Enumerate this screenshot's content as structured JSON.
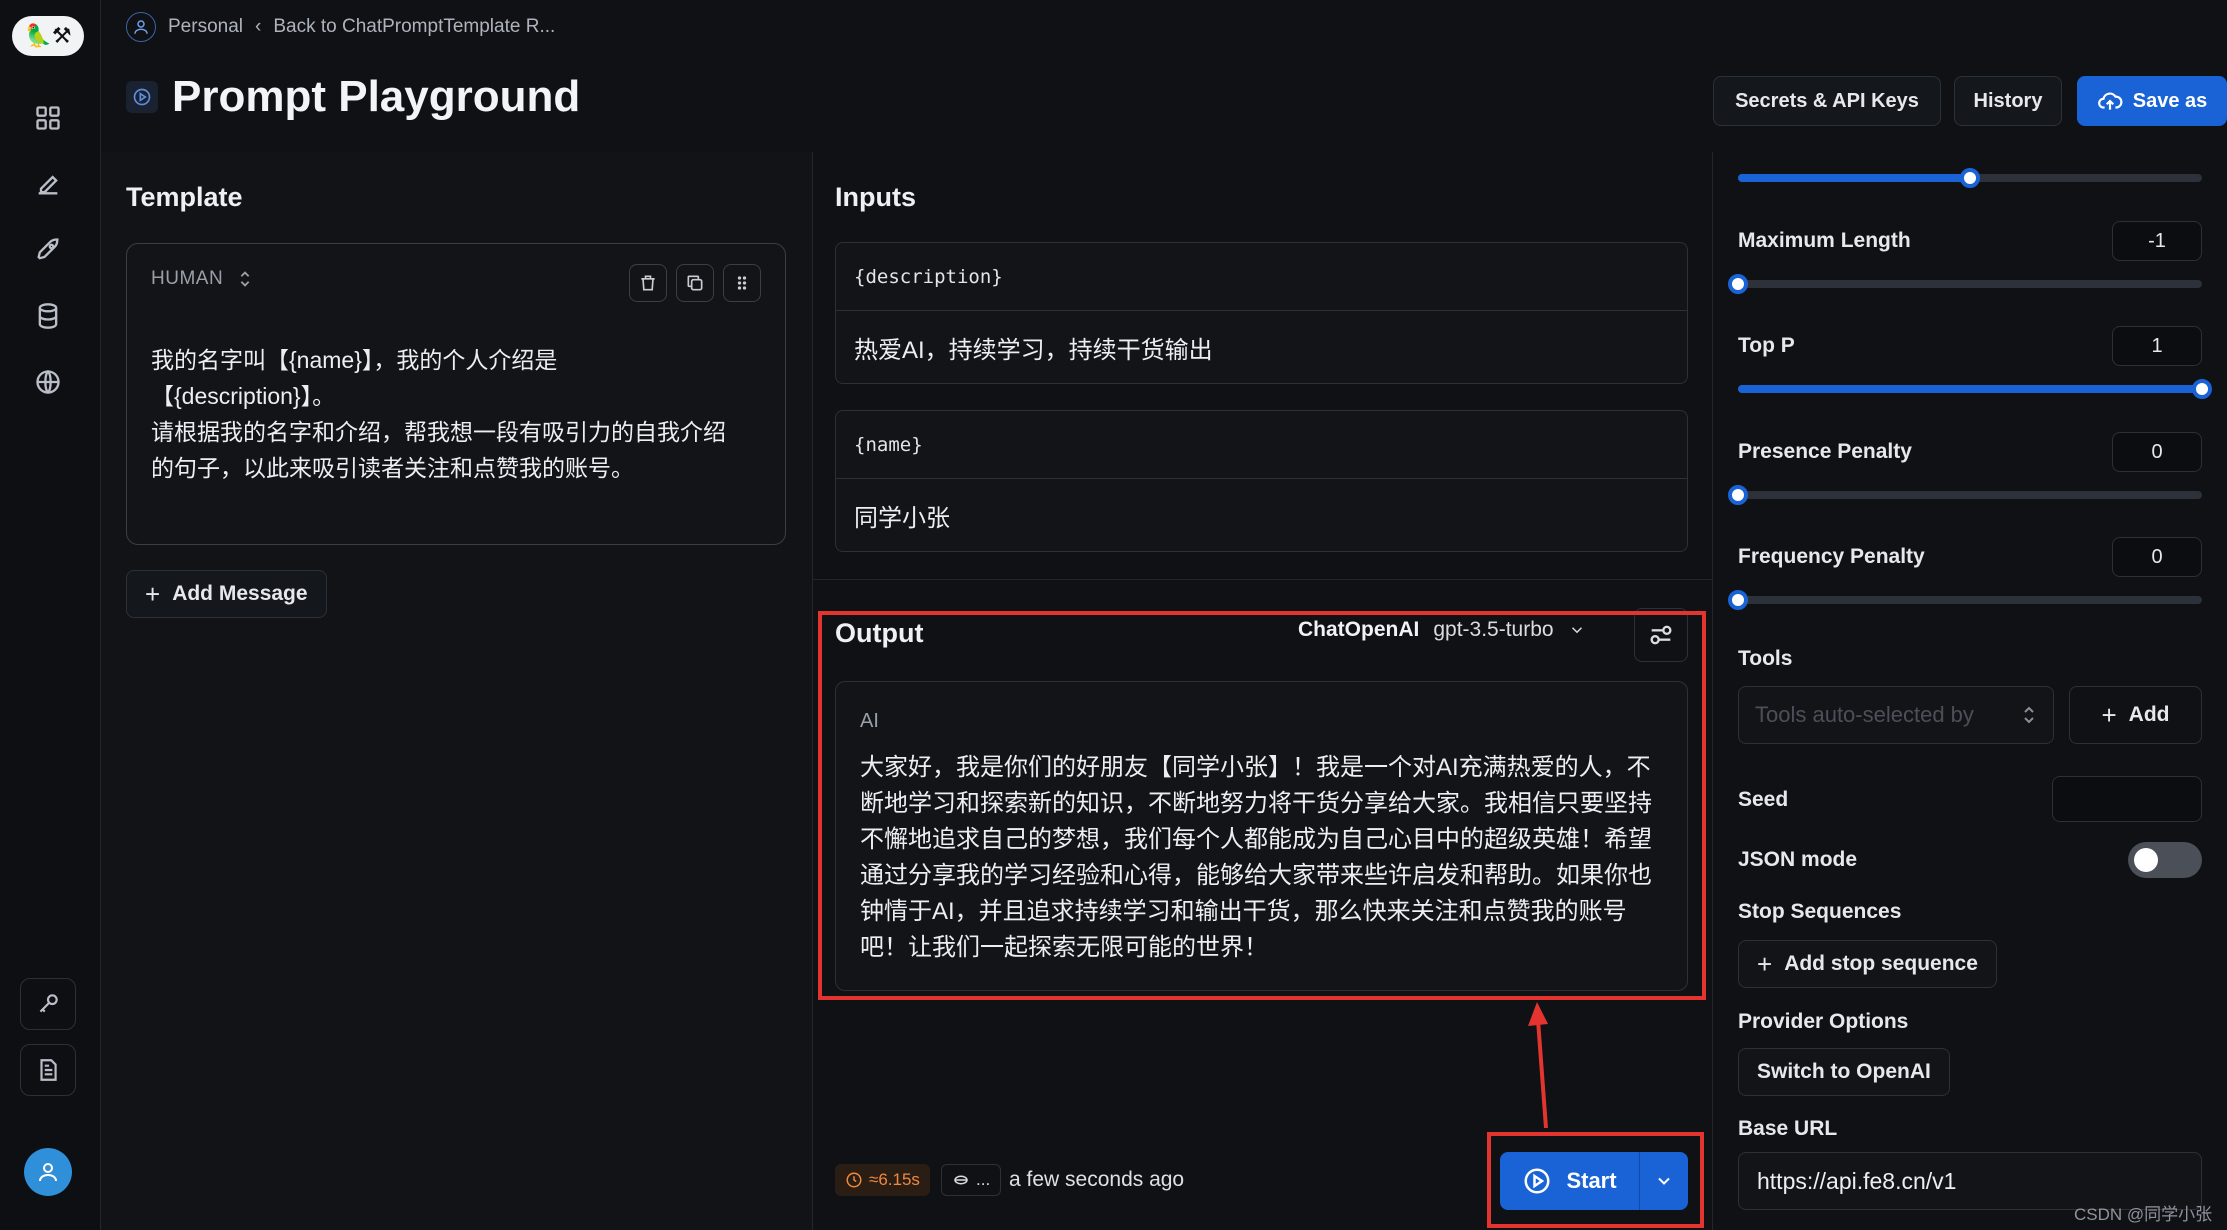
{
  "breadcrumb": {
    "workspace": "Personal",
    "back": "Back to ChatPromptTemplate R..."
  },
  "header": {
    "title": "Prompt Playground",
    "secrets_label": "Secrets & API Keys",
    "history_label": "History",
    "save_label": "Save as"
  },
  "template": {
    "title": "Template",
    "role": "HUMAN",
    "message": "我的名字叫【{name}】，我的个人介绍是\n【{description}】。\n请根据我的名字和介绍，帮我想一段有吸引力的自我介绍\n的句子，以此来吸引读者关注和点赞我的账号。",
    "add_message": "Add Message"
  },
  "inputs": {
    "title": "Inputs",
    "items": [
      {
        "key": "{description}",
        "value": "热爱AI，持续学习，持续干货输出"
      },
      {
        "key": "{name}",
        "value": "同学小张"
      }
    ]
  },
  "output": {
    "title": "Output",
    "provider": "ChatOpenAI",
    "model": "gpt-3.5-turbo",
    "role": "AI",
    "text": "大家好，我是你们的好朋友【同学小张】！我是一个对AI充满热爱的人，不断地学习和探索新的知识，不断地努力将干货分享给大家。我相信只要坚持不懈地追求自己的梦想，我们每个人都能成为自己心目中的超级英雄！希望通过分享我的学习经验和心得，能够给大家带来些许启发和帮助。如果你也钟情于AI，并且追求持续学习和输出干货，那么快来关注和点赞我的账号吧！让我们一起探索无限可能的世界！",
    "timing": "≈6.15s",
    "tokens": "...",
    "updated": "a few seconds ago",
    "start_label": "Start"
  },
  "settings": {
    "sliders": {
      "top_slider": 0.5,
      "max_length": 0.0,
      "top_p": 1.0,
      "presence_penalty": 0.0,
      "frequency_penalty": 0.0
    },
    "max_length_label": "Maximum Length",
    "max_length_value": "-1",
    "top_p_label": "Top P",
    "top_p_value": "1",
    "presence_label": "Presence Penalty",
    "presence_value": "0",
    "frequency_label": "Frequency Penalty",
    "frequency_value": "0",
    "tools_label": "Tools",
    "tools_placeholder": "Tools auto-selected by",
    "tools_add": "Add",
    "seed_label": "Seed",
    "json_mode_label": "JSON mode",
    "json_mode_on": false,
    "stop_label": "Stop Sequences",
    "stop_add": "Add stop sequence",
    "provider_label": "Provider Options",
    "provider_switch": "Switch to OpenAI",
    "base_url_label": "Base URL",
    "base_url_value": "https://api.fe8.cn/v1"
  },
  "watermark": "CSDN @同学小张",
  "colors": {
    "accent": "#1a63d6",
    "highlight": "#e3342f",
    "timing": "#f0883e"
  }
}
